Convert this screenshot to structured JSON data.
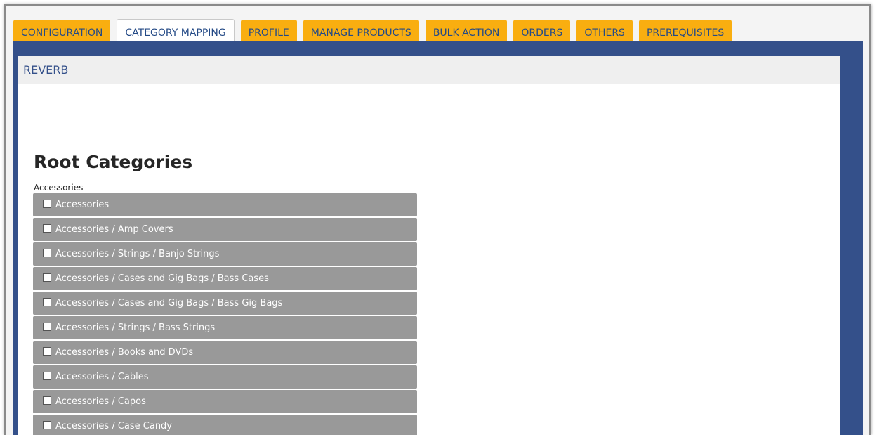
{
  "tabs": [
    {
      "label": "CONFIGURATION",
      "active": false
    },
    {
      "label": "CATEGORY MAPPING",
      "active": true
    },
    {
      "label": "PROFILE",
      "active": false
    },
    {
      "label": "MANAGE PRODUCTS",
      "active": false
    },
    {
      "label": "BULK ACTION",
      "active": false
    },
    {
      "label": "ORDERS",
      "active": false
    },
    {
      "label": "OTHERS",
      "active": false
    },
    {
      "label": "PREREQUISITES",
      "active": false
    }
  ],
  "panel": {
    "header": "REVERB",
    "section_title": "Root Categories",
    "group_label": "Accessories",
    "categories": [
      {
        "label": "Accessories",
        "checked": false
      },
      {
        "label": "Accessories / Amp Covers",
        "checked": false
      },
      {
        "label": "Accessories / Strings / Banjo Strings",
        "checked": false
      },
      {
        "label": "Accessories / Cases and Gig Bags / Bass Cases",
        "checked": false
      },
      {
        "label": "Accessories / Cases and Gig Bags / Bass Gig Bags",
        "checked": false
      },
      {
        "label": "Accessories / Strings / Bass Strings",
        "checked": false
      },
      {
        "label": "Accessories / Books and DVDs",
        "checked": false
      },
      {
        "label": "Accessories / Cables",
        "checked": false
      },
      {
        "label": "Accessories / Capos",
        "checked": false
      },
      {
        "label": "Accessories / Case Candy",
        "checked": false
      }
    ]
  },
  "colors": {
    "tab_bg": "#f9ae10",
    "tab_text": "#244a86",
    "panel_blue": "#34508a",
    "row_gray": "#999999"
  }
}
